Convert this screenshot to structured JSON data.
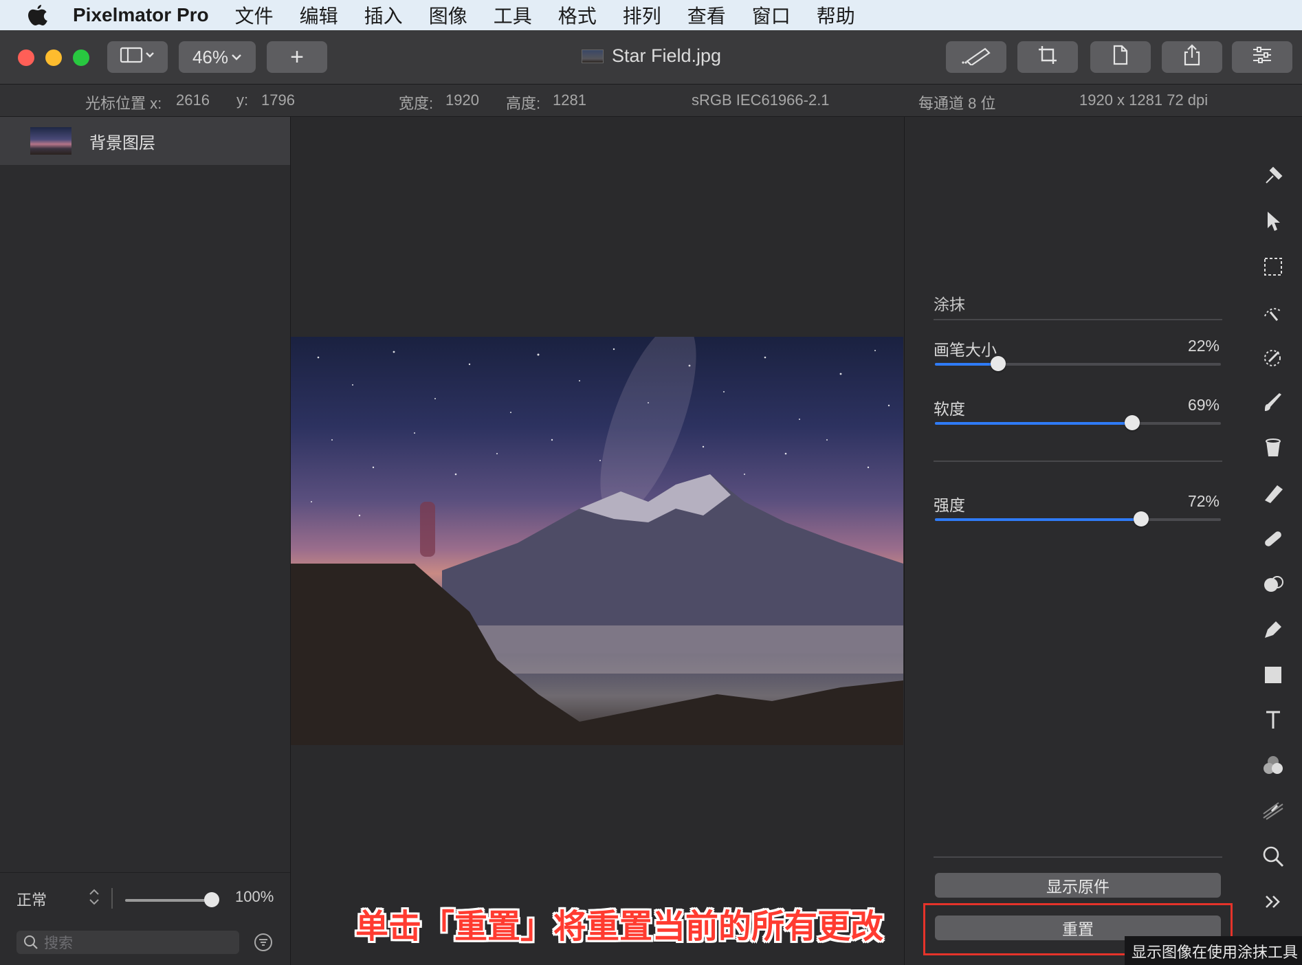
{
  "menubar": {
    "app_name": "Pixelmator Pro",
    "items": [
      "文件",
      "编辑",
      "插入",
      "图像",
      "工具",
      "格式",
      "排列",
      "查看",
      "窗口",
      "帮助"
    ]
  },
  "toolbar": {
    "zoom": "46%",
    "add_label": "+",
    "document_title": "Star Field.jpg"
  },
  "infobar": {
    "cursor_x_label": "光标位置 x:",
    "cursor_x": "2616",
    "cursor_y_label": "y:",
    "cursor_y": "1796",
    "width_label": "宽度:",
    "width": "1920",
    "height_label": "高度:",
    "height": "1281",
    "color_profile": "sRGB IEC61966-2.1",
    "bit_depth": "每通道 8 位",
    "dimensions_dpi": "1920 x 1281 72 dpi"
  },
  "layers": {
    "items": [
      {
        "name": "背景图层"
      }
    ],
    "blend_mode": "正常",
    "opacity": "100%",
    "opacity_fraction": 1.0,
    "search_placeholder": "搜索"
  },
  "canvas": {
    "annotation": "单击「重置」将重置当前的所有更改"
  },
  "inspector": {
    "tool_title": "涂抹",
    "params": [
      {
        "label": "画笔大小",
        "value": "22%",
        "fraction": 0.22
      },
      {
        "label": "软度",
        "value": "69%",
        "fraction": 0.69
      },
      {
        "label": "强度",
        "value": "72%",
        "fraction": 0.72
      }
    ],
    "show_original": "显示原件",
    "reset": "重置",
    "tooltip": "显示图像在使用涂抹工具"
  },
  "tools": [
    "arrange-icon",
    "select-pointer-icon",
    "rect-selection-icon",
    "magic-selection-icon",
    "color-picker-icon",
    "paint-brush-icon",
    "fill-bucket-icon",
    "eraser-icon",
    "repair-icon",
    "clone-icon",
    "pen-icon",
    "shape-icon",
    "type-icon",
    "color-adjust-icon",
    "smudge-icon",
    "zoom-icon",
    "more-tools-icon"
  ],
  "colors": {
    "accent": "#2f7bf6",
    "highlight": "#e5332a"
  }
}
